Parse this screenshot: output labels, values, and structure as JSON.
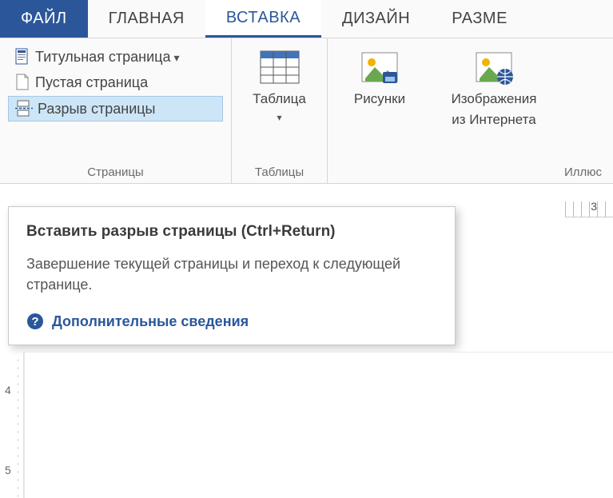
{
  "tabs": {
    "file": "ФАЙЛ",
    "home": "ГЛАВНАЯ",
    "insert": "ВСТАВКА",
    "design": "ДИЗАЙН",
    "layout": "РАЗМЕ"
  },
  "ribbon": {
    "pages": {
      "title_page": "Титульная страница",
      "blank_page": "Пустая страница",
      "page_break": "Разрыв страницы",
      "group_label": "Страницы"
    },
    "tables": {
      "table": "Таблица",
      "group_label": "Таблицы"
    },
    "illustrations": {
      "pictures": "Рисунки",
      "online_pictures_l1": "Изображения",
      "online_pictures_l2": "из Интернета",
      "group_label": "Иллюс"
    }
  },
  "tooltip": {
    "title": "Вставить разрыв страницы (Ctrl+Return)",
    "body": "Завершение текущей страницы и переход к следующей странице.",
    "help": "Дополнительные сведения"
  },
  "ruler": {
    "h_num": "3",
    "v4": "4",
    "v5": "5"
  }
}
